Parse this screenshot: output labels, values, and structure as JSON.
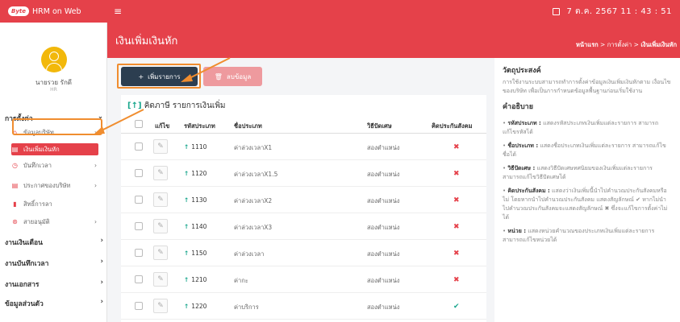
{
  "app": {
    "logo_text": "Byte",
    "title": "HRM on Web"
  },
  "topbar": {
    "hamburger": "≡",
    "clock": "7 ต.ค. 2567  11 : 43 : 51"
  },
  "user": {
    "name": "นายรวย รักดี",
    "role": "HR"
  },
  "sidebar": {
    "sections": [
      {
        "label": "การตั้งค่า",
        "chevron": "⌄"
      },
      {
        "label": "งานเงินเดือน",
        "chevron": "›"
      },
      {
        "label": "งานบันทึกเวลา",
        "chevron": "›"
      },
      {
        "label": "งานเอกสาร",
        "chevron": "›"
      },
      {
        "label": "ข้อมูลส่วนตัว",
        "chevron": "›"
      }
    ],
    "items": [
      {
        "label": "ข้อมูลบริษัท",
        "icon": "home-icon",
        "chevron": "›"
      },
      {
        "label": "เงินเพิ่มเงินหัก",
        "icon": "list-icon",
        "chevron": ""
      },
      {
        "label": "บันทึกเวลา",
        "icon": "clock-icon",
        "chevron": "›"
      },
      {
        "label": "ประกาศของบริษัท",
        "icon": "list-icon",
        "chevron": "›"
      },
      {
        "label": "สิทธิ์การลา",
        "icon": "doc-icon",
        "chevron": ""
      },
      {
        "label": "สายอนุมัติ",
        "icon": "approval-icon",
        "chevron": "›"
      }
    ]
  },
  "page": {
    "title": "เงินเพิ่มเงินหัก"
  },
  "breadcrumb": {
    "home": "หน้าแรก",
    "sep": ">",
    "level1": "การตั้งค่า",
    "current": "เงินเพิ่มเงินหัก"
  },
  "toolbar": {
    "add_label": "เพิ่มรายการ",
    "add_icon": "+",
    "delete_label": "ลบข้อมูล",
    "delete_icon": "🗑"
  },
  "table": {
    "title_marker": "[↑]",
    "title": "คิดภาษี รายการเงินเพิ่ม",
    "headers": {
      "edit": "แก้ไข",
      "code": "รหัสประเภท",
      "name": "ชื่อประเภท",
      "method": "วิธีปัดเศษ",
      "social": "คิดประกันสังคม"
    },
    "rows": [
      {
        "code": "1110",
        "name": "ค่าล่วงเวลาX1",
        "method": "สองตำแหน่ง",
        "social": "no"
      },
      {
        "code": "1120",
        "name": "ค่าล่วงเวลาX1.5",
        "method": "สองตำแหน่ง",
        "social": "no"
      },
      {
        "code": "1130",
        "name": "ค่าล่วงเวลาX2",
        "method": "สองตำแหน่ง",
        "social": "no"
      },
      {
        "code": "1140",
        "name": "ค่าล่วงเวลาX3",
        "method": "สองตำแหน่ง",
        "social": "no"
      },
      {
        "code": "1150",
        "name": "ค่าล่วงเวลา",
        "method": "สองตำแหน่ง",
        "social": "no"
      },
      {
        "code": "1210",
        "name": "ค่ากะ",
        "method": "สองตำแหน่ง",
        "social": "no"
      },
      {
        "code": "1220",
        "name": "ค่าบริการ",
        "method": "สองตำแหน่ง",
        "social": "yes"
      }
    ]
  },
  "info": {
    "objective_title": "วัตถุประสงค์",
    "objective_text": "การใช้งานระบบสามารถทำการตั้งค่าข้อมูลเงินเพิ่มเงินหักตาม เงื่อนไขของบริษัท เพื่อเป็นการกำหนดข้อมูลพื้นฐานก่อนเริ่มใช้งาน",
    "desc_title": "คำอธิบาย",
    "bullets": [
      {
        "term": "รหัสประเภท :",
        "text": "แสดงรหัสประเภทเงินเพิ่มแต่ละรายการ สามารถแก้ไขรหัสได้"
      },
      {
        "term": "ชื่อประเภท :",
        "text": "แสดงชื่อประเภทเงินเพิ่มแต่ละรายการ สามารถแก้ไขชื่อได้"
      },
      {
        "term": "วิธีปัดเศษ :",
        "text": "แสดงวิธีปัดเศษทศนิยมของเงินเพิ่มแต่ละรายการ สามารถแก้ไขวิธีปัดเศษได้"
      },
      {
        "term": "คิดประกันสังคม :",
        "text": "แสดงว่าเงินเพิ่มนี้นำไปคำนวณประกันสังคมหรือไม่ โดยหากนำไปคำนวณประกันสังคม แสดงสัญลักษณ์ ✔ หากไม่นำไปคำนวณประกันสังคมจะแสดงสัญลักษณ์ ✖ ซึ่งจะแก้ไขการตั้งค่าไม่ได้"
      },
      {
        "term": "หน่วย :",
        "text": "แสดงหน่วยคำนวณของประเภทเงินเพิ่มแต่ละรายการ สามารถแก้ไขหน่วยได้"
      }
    ]
  },
  "marks": {
    "yes": "✔",
    "no": "✖",
    "pencil": "✎",
    "up_arrow": "↑"
  },
  "colors": {
    "brand_red": "#e5414a",
    "nav_dark": "#2c3e50",
    "accent_green": "#18a68c",
    "highlight_orange": "#f08d2f"
  }
}
